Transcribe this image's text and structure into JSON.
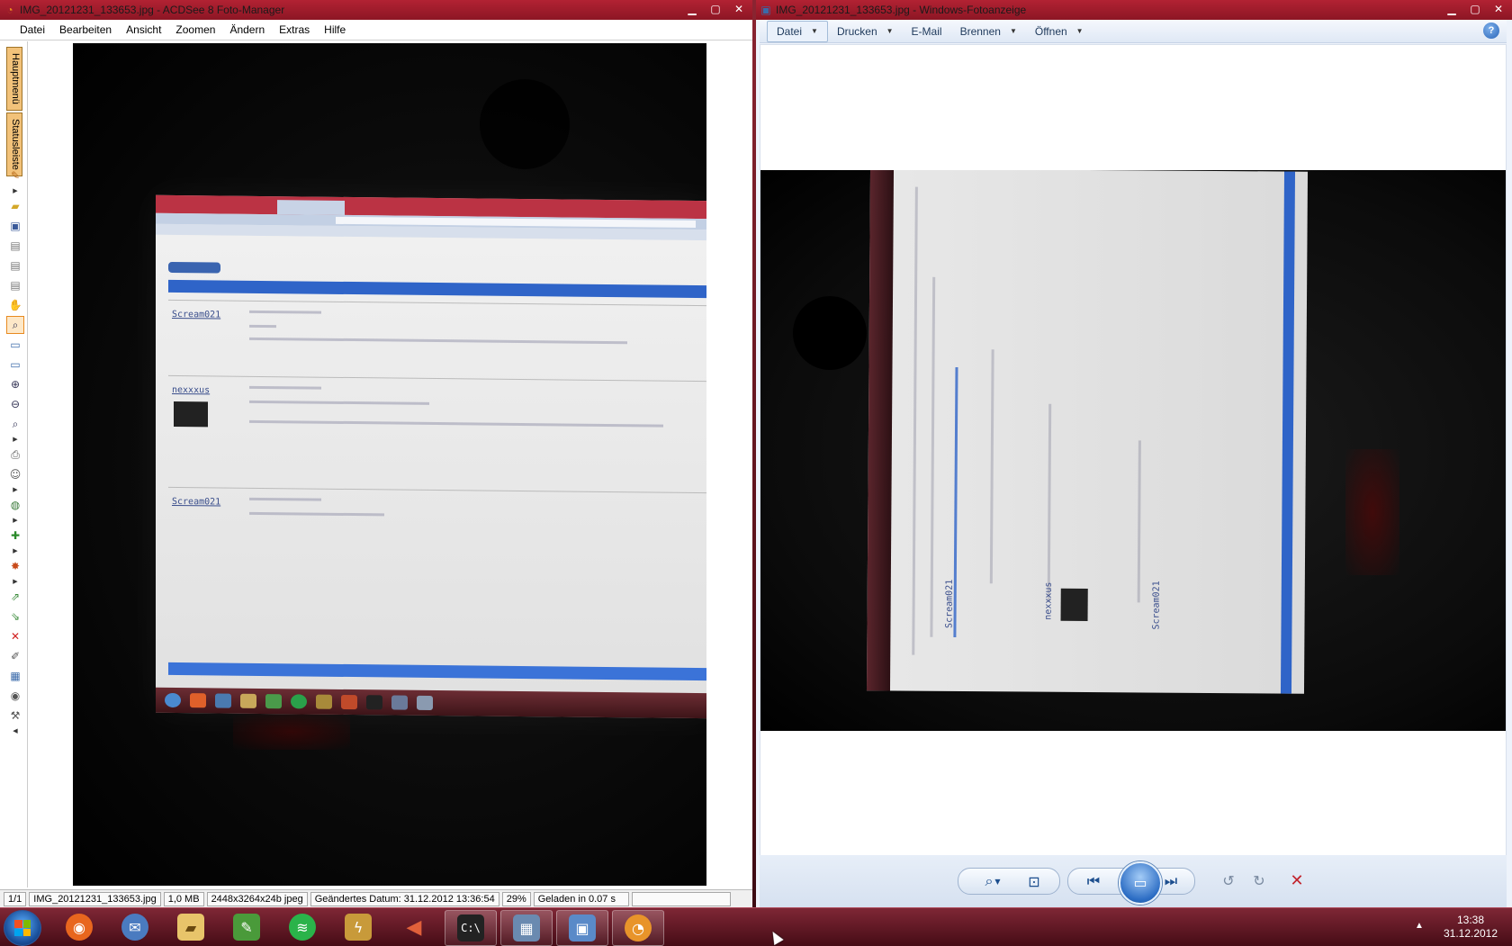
{
  "acdsee": {
    "title": "IMG_20121231_133653.jpg - ACDSee 8 Foto-Manager",
    "menu": [
      "Datei",
      "Bearbeiten",
      "Ansicht",
      "Zoomen",
      "Ändern",
      "Extras",
      "Hilfe"
    ],
    "sidetabs": [
      "Hauptmenü",
      "Statusleiste"
    ],
    "toolbar_icons": [
      "edit-icon",
      "open-folder-icon",
      "save-icon",
      "image-icon",
      "image-icon",
      "image-icon",
      "hand-icon",
      "zoom-tool-icon",
      "fit-icon",
      "fit-icon",
      "zoom-in-icon",
      "zoom-out-icon",
      "zoom-icon",
      "print-icon",
      "user-icon",
      "globe-icon",
      "plugin-icon",
      "plugin-icon",
      "export-icon",
      "export-icon",
      "delete-icon",
      "rename-icon",
      "slideshow-icon",
      "view-icon",
      "tools-icon"
    ],
    "photo_text": {
      "user1": "Scream021",
      "user2": "nexxxus",
      "user3": "Scream021"
    },
    "status": {
      "index": "1/1",
      "filename": "IMG_20121231_133653.jpg",
      "filesize": "1,0 MB",
      "dimensions": "2448x3264x24b jpeg",
      "modified": "Geändertes Datum: 31.12.2012 13:36:54",
      "zoom": "29%",
      "loaded": "Geladen in 0.07 s"
    }
  },
  "photoviewer": {
    "title": "IMG_20121231_133653.jpg - Windows-Fotoanzeige",
    "commands": [
      {
        "label": "Datei",
        "has_caret": true
      },
      {
        "label": "Drucken",
        "has_caret": true
      },
      {
        "label": "E-Mail",
        "has_caret": false
      },
      {
        "label": "Brennen",
        "has_caret": true
      },
      {
        "label": "Öffnen",
        "has_caret": true
      }
    ],
    "help_label": "?",
    "photo_text": {
      "user1": "Scream021",
      "user2": "nexxxus",
      "user3": "Scream021"
    }
  },
  "taskbar": {
    "apps": [
      {
        "name": "firefox",
        "open": false,
        "color": "#e8661e"
      },
      {
        "name": "thunderbird",
        "open": false,
        "color": "#4a7bc0"
      },
      {
        "name": "explorer",
        "open": false,
        "color": "#e8c46a"
      },
      {
        "name": "notepad",
        "open": false,
        "color": "#4a9a3a"
      },
      {
        "name": "spotify",
        "open": false,
        "color": "#2ab34a"
      },
      {
        "name": "winamp",
        "open": false,
        "color": "#c89a3a"
      },
      {
        "name": "volume",
        "open": false,
        "color": "#c84a2a"
      },
      {
        "name": "cmd",
        "open": true,
        "color": "#222222"
      },
      {
        "name": "video",
        "open": true,
        "color": "#6a8ab0"
      },
      {
        "name": "photoviewer",
        "open": true,
        "color": "#5a8ac8"
      },
      {
        "name": "acdsee",
        "open": true,
        "color": "#e8942a"
      }
    ],
    "clock": {
      "time": "13:38",
      "date": "31.12.2012"
    }
  }
}
